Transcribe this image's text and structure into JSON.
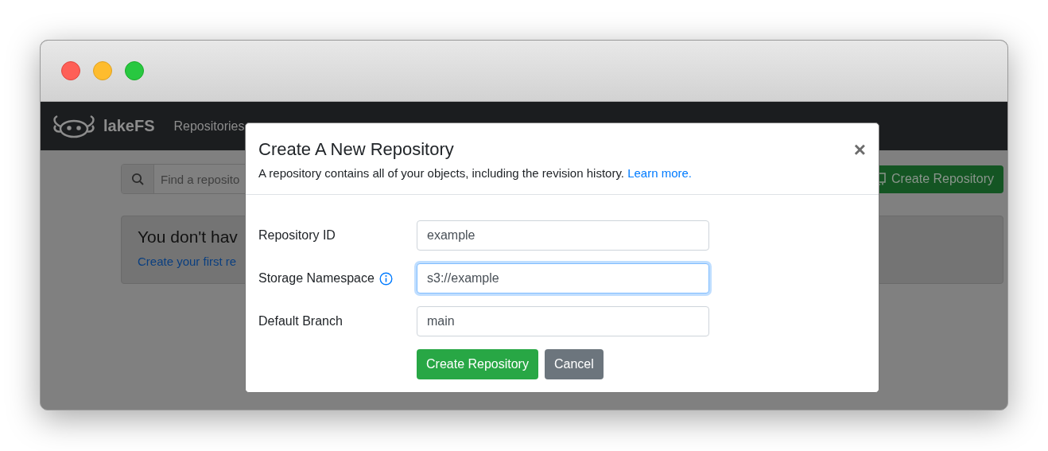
{
  "navbar": {
    "brand": "lakeFS",
    "links": [
      {
        "label": "Repositories"
      }
    ]
  },
  "page": {
    "search": {
      "placeholder": "Find a reposito"
    },
    "create_button": "Create Repository",
    "empty_state": {
      "heading": "You don't hav",
      "link": "Create your first re"
    }
  },
  "modal": {
    "title": "Create A New Repository",
    "subtitle": "A repository contains all of your objects, including the revision history.",
    "subtitle_link": "Learn more.",
    "close": "×",
    "fields": [
      {
        "label": "Repository ID",
        "value": "example",
        "info": false,
        "focused": false
      },
      {
        "label": "Storage Namespace",
        "value": "s3://example",
        "info": true,
        "focused": true
      },
      {
        "label": "Default Branch",
        "value": "main",
        "info": false,
        "focused": false
      }
    ],
    "buttons": [
      {
        "label": "Create Repository",
        "kind": "primary"
      },
      {
        "label": "Cancel",
        "kind": "secondary"
      }
    ]
  }
}
